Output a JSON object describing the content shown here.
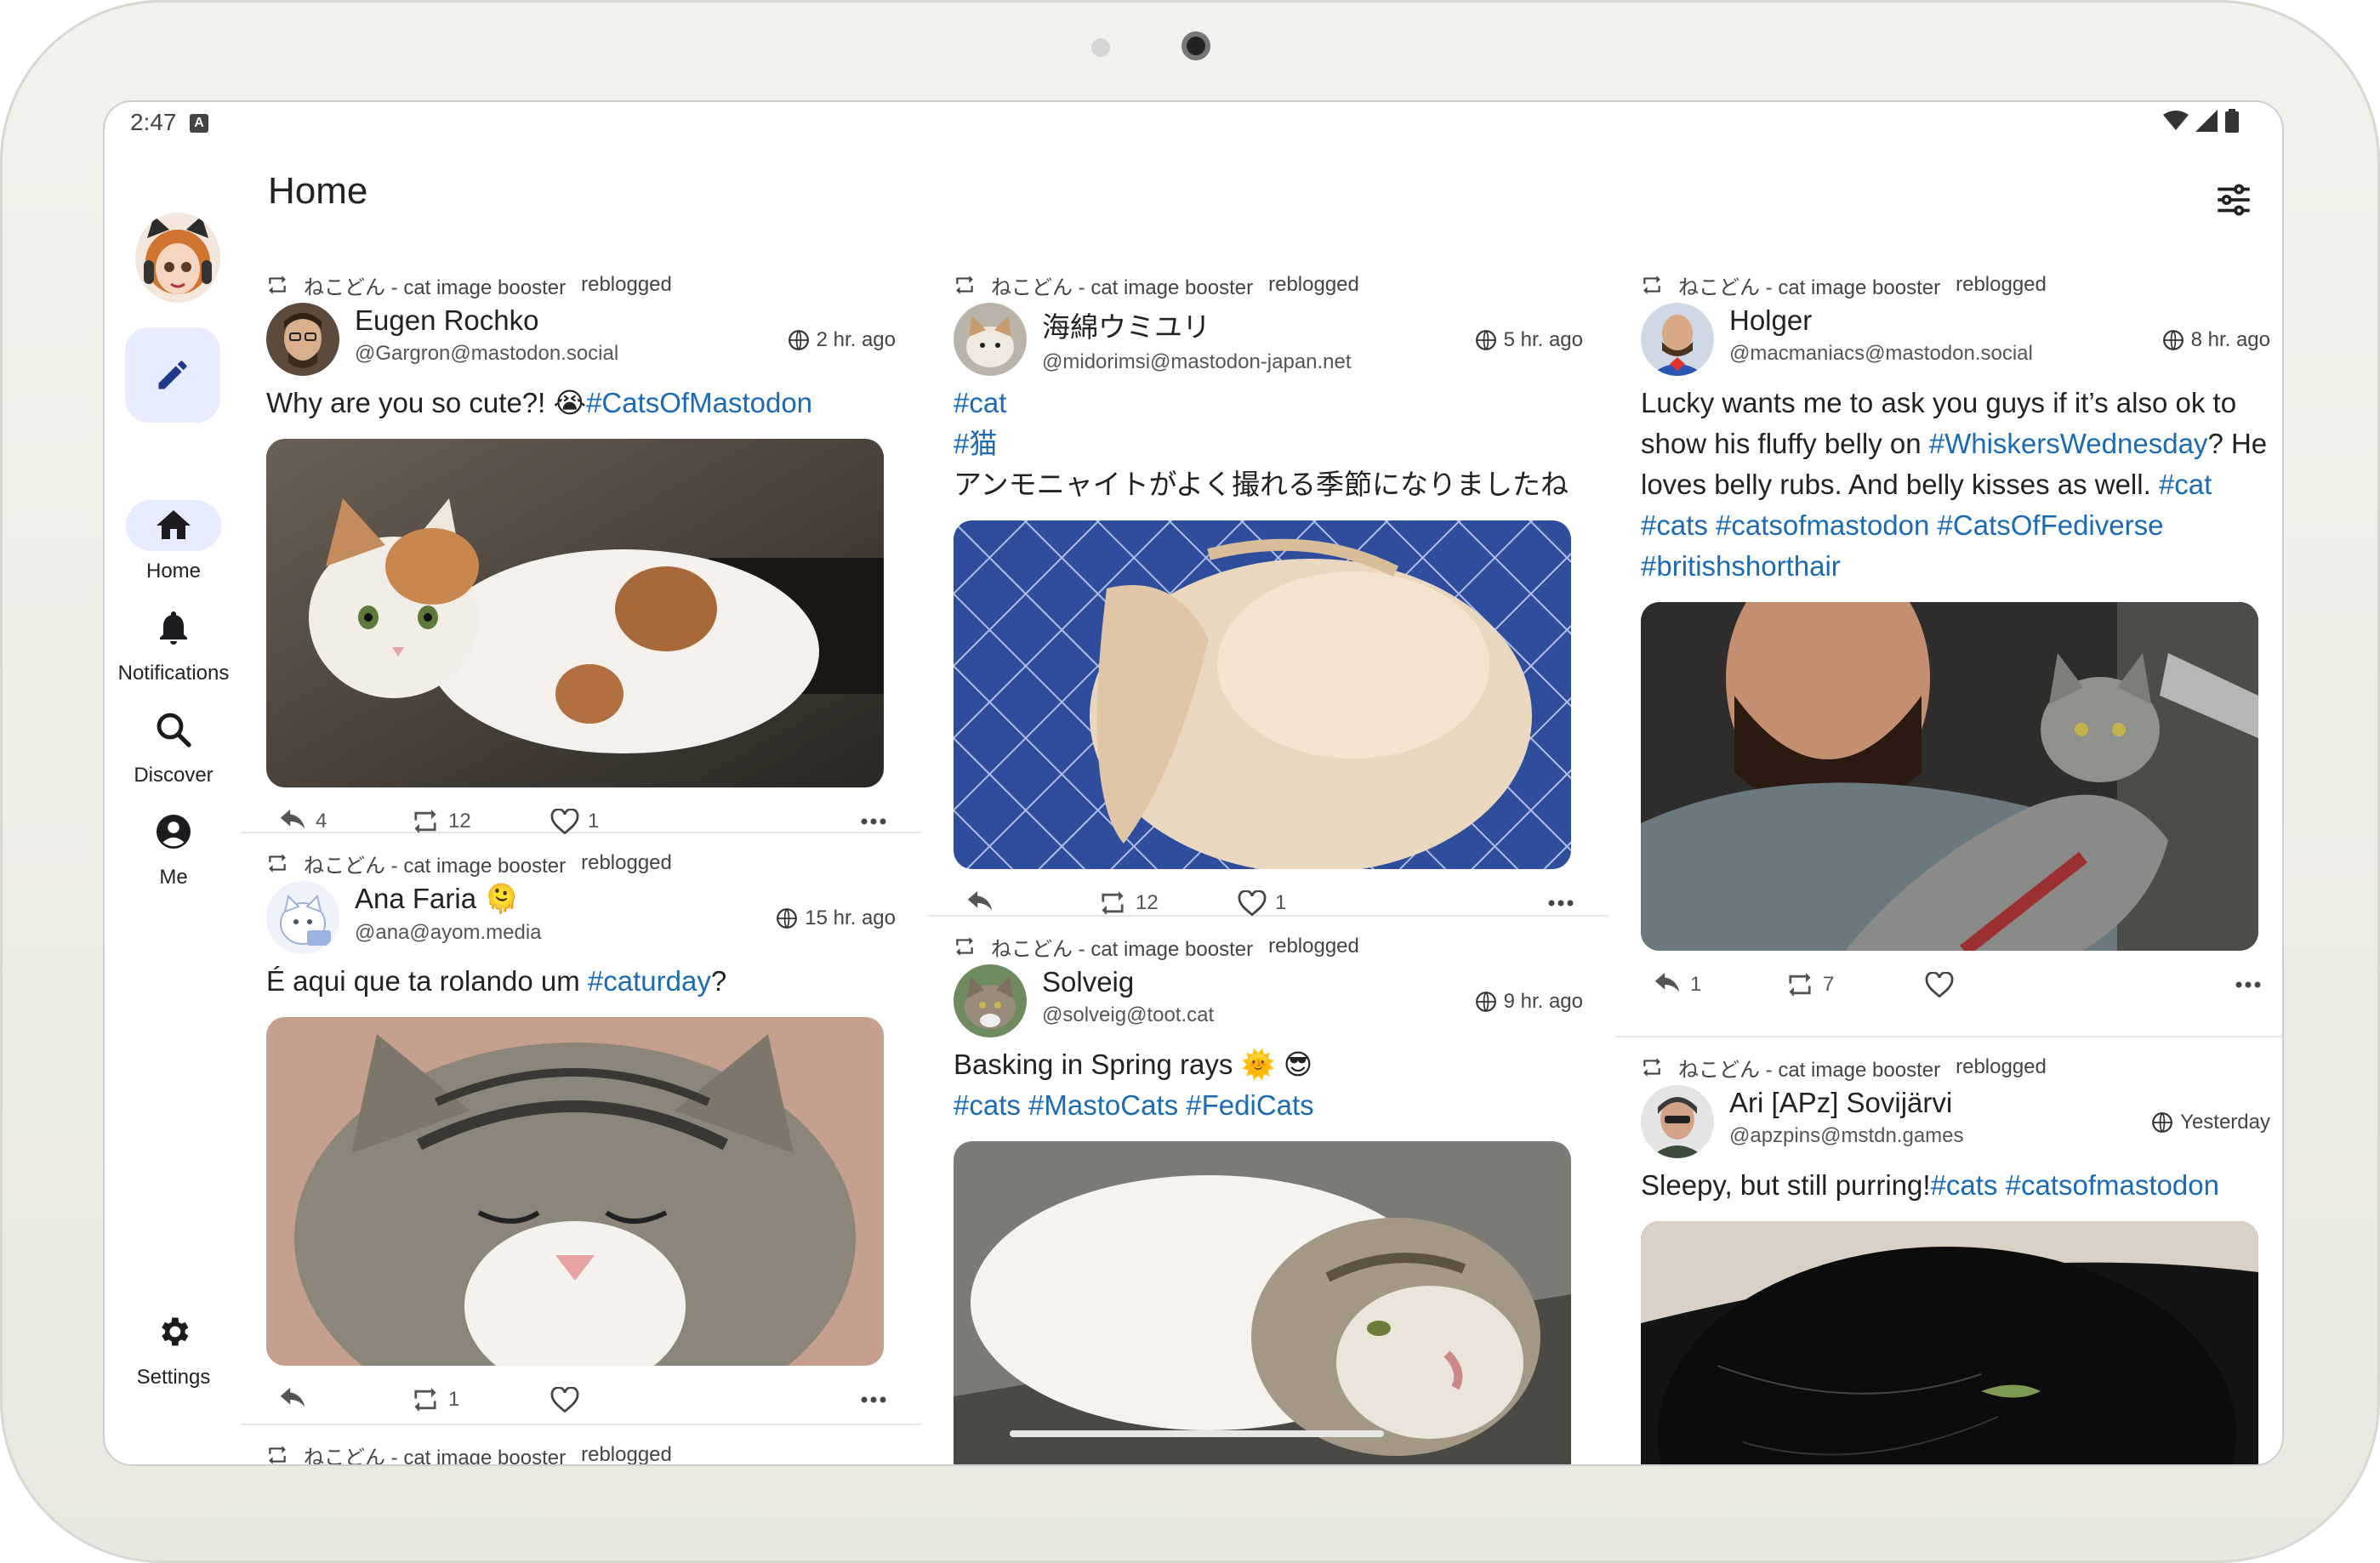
{
  "status": {
    "time": "2:47"
  },
  "header": {
    "title": "Home"
  },
  "rail": {
    "items": [
      {
        "label": "Home",
        "icon": "home-icon",
        "active": true
      },
      {
        "label": "Notifications",
        "icon": "bell-icon"
      },
      {
        "label": "Discover",
        "icon": "search-icon"
      },
      {
        "label": "Me",
        "icon": "account-icon"
      }
    ],
    "settings_label": "Settings"
  },
  "booster": {
    "name": "ねこどん - cat image booster",
    "action": "reblogged"
  },
  "columns": [
    [
      {
        "name": "Eugen Rochko",
        "handle": "@Gargron@mastodon.social",
        "time": "2 hr. ago",
        "content": [
          {
            "t": "Why are you so cute?! 😭"
          },
          {
            "t": "#CatsOfMastodon",
            "tag": true
          }
        ],
        "replies": "4",
        "boosts": "12",
        "favs": "1"
      },
      {
        "name": "Ana Faria 🫠",
        "handle": "@ana@ayom.media",
        "time": "15 hr. ago",
        "content": [
          {
            "t": "É aqui que ta rolando um "
          },
          {
            "t": "#caturday",
            "tag": true
          },
          {
            "t": "?"
          }
        ],
        "replies": "",
        "boosts": "1",
        "favs": ""
      },
      {
        "name": "",
        "handle": "",
        "time": "",
        "content": [],
        "replies": "",
        "boosts": "",
        "favs": ""
      }
    ],
    [
      {
        "name": "海綿ウミユリ",
        "handle": "@midorimsi@mastodon-japan.net",
        "time": "5 hr. ago",
        "content": [
          {
            "t": "#cat",
            "tag": true,
            "br": true
          },
          {
            "t": "#猫",
            "tag": true,
            "br": true
          },
          {
            "t": "アンモニャイトがよく撮れる季節になりましたね"
          }
        ],
        "replies": "",
        "boosts": "12",
        "favs": "1"
      },
      {
        "name": "Solveig",
        "handle": "@solveig@toot.cat",
        "time": "9 hr. ago",
        "content": [
          {
            "t": "Basking in Spring rays 🌞 😎",
            "br": true
          },
          {
            "t": "#cats #MastoCats #FediCats",
            "tag": true
          }
        ],
        "replies": "",
        "boosts": "",
        "favs": ""
      }
    ],
    [
      {
        "name": "Holger",
        "handle": "@macmaniacs@mastodon.social",
        "time": "8 hr. ago",
        "content": [
          {
            "t": "Lucky wants me to ask you guys if it’s also ok to show his fluffy belly on "
          },
          {
            "t": "#WhiskersWednesday",
            "tag": true
          },
          {
            "t": "? He loves belly rubs. And belly kisses as well. "
          },
          {
            "t": "#cat #cats #catsofmastodon #CatsOfFediverse #britishshorthair",
            "tag": true
          }
        ],
        "replies": "1",
        "boosts": "7",
        "favs": ""
      },
      {
        "name": "Ari [APz] Sovijärvi",
        "handle": "@apzpins@mstdn.games",
        "time": "Yesterday",
        "content": [
          {
            "t": "Sleepy, but still purring!"
          },
          {
            "t": "#cats #catsofmastodon",
            "tag": true
          }
        ],
        "replies": "",
        "boosts": "",
        "favs": ""
      }
    ]
  ],
  "colors": {
    "accent": "#1c6ab4",
    "rail_active": "#e7ebff"
  }
}
